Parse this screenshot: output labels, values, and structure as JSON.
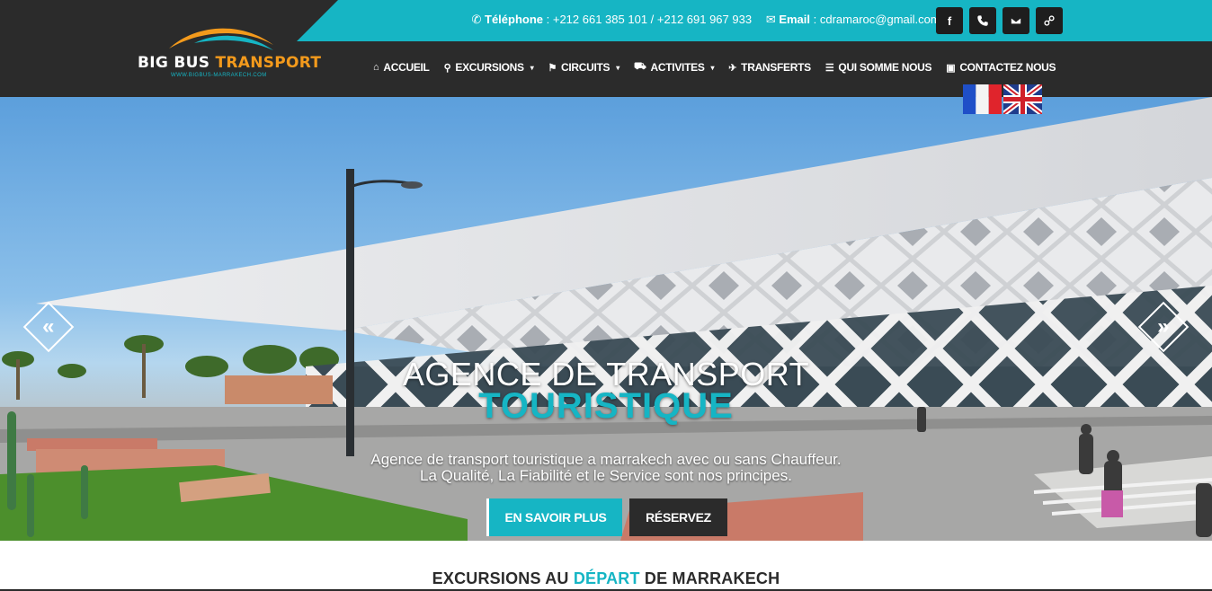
{
  "header": {
    "logo": {
      "word1": "BIG",
      "word2": "BUS",
      "word3": "TRANSPORT",
      "url": "WWW.BIGBUS-MARRAKECH.COM"
    },
    "contact": {
      "phone_label": "Téléphone",
      "phone_value": ": +212 661 385 101 / +212 691 967 933",
      "email_label": "Email",
      "email_value": ": cdramaroc@gmail.com",
      "phone_icon": "phone-icon",
      "email_icon": "envelope-icon"
    },
    "social": [
      {
        "icon": "facebook-icon",
        "glyph": "f"
      },
      {
        "icon": "phone-icon"
      },
      {
        "icon": "envelope-icon"
      },
      {
        "icon": "link-icon"
      }
    ],
    "nav": [
      {
        "label": "ACCUEIL",
        "icon": "home-icon",
        "glyph": "⌂",
        "dropdown": false
      },
      {
        "label": "EXCURSIONS",
        "icon": "map-marker-icon",
        "glyph": "⚲",
        "dropdown": true
      },
      {
        "label": "CIRCUITS",
        "icon": "signpost-icon",
        "glyph": "⚑",
        "dropdown": true
      },
      {
        "label": "ACTIVITES",
        "icon": "car-icon",
        "glyph": "⛟",
        "dropdown": true
      },
      {
        "label": "TRANSFERTS",
        "icon": "plane-icon",
        "glyph": "✈",
        "dropdown": false
      },
      {
        "label": "QUI SOMME NOUS",
        "icon": "list-icon",
        "glyph": "☰",
        "dropdown": false
      },
      {
        "label": "CONTACTEZ NOUS",
        "icon": "briefcase-icon",
        "glyph": "▣",
        "dropdown": false
      }
    ],
    "caret": "▾",
    "flags": [
      {
        "name": "french-flag-icon",
        "lang": "fr"
      },
      {
        "name": "uk-flag-icon",
        "lang": "en"
      }
    ]
  },
  "hero": {
    "title_line1": "AGENCE DE TRANSPORT",
    "title_line2": "TOURISTIQUE",
    "subtitle_line1": "Agence de transport touristique a marrakech avec ou sans Chauffeur.",
    "subtitle_line2": "La Qualité, La Fiabilité et le Service sont nos principes.",
    "prev_glyph": "«",
    "next_glyph": "»",
    "buttons": {
      "learn_more": "EN SAVOIR PLUS",
      "reserve": "RÉSERVEZ"
    }
  },
  "section": {
    "title_part1": "EXCURSIONS AU",
    "title_accent": "DÉPART",
    "title_part2": "DE MARRAKECH"
  },
  "colors": {
    "accent": "#16b5c4",
    "dark": "#2b2b2b",
    "logo_orange": "#f39a1c"
  }
}
